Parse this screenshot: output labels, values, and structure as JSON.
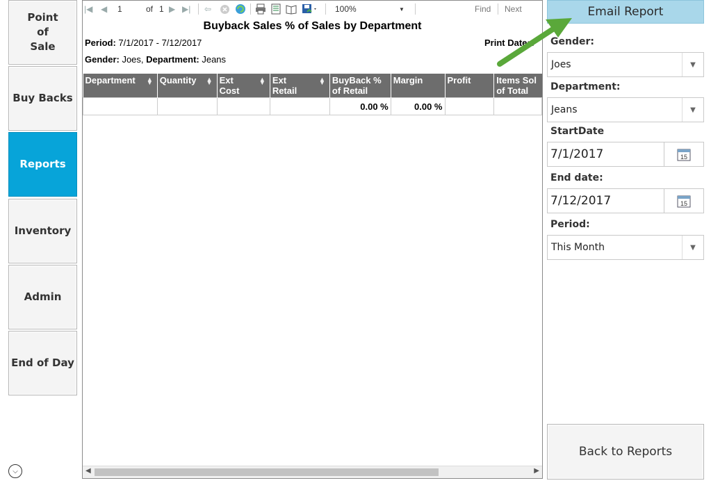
{
  "nav": {
    "point_of_sale": "Point\nof\nSale",
    "buy_backs": "Buy Backs",
    "reports": "Reports",
    "inventory": "Inventory",
    "admin": "Admin",
    "end_of_day": "End of Day"
  },
  "toolbar": {
    "page_current": "1",
    "page_of": "of",
    "page_total": "1",
    "zoom": "100%",
    "find": "Find",
    "next": "Next"
  },
  "report": {
    "title": "Buyback Sales % of Sales by Department",
    "period_label": "Period:",
    "period_value": " 7/1/2017 - 7/12/2017",
    "print_date_label": "Print Date:",
    "print_date_value": " /",
    "gender_label": "Gender:",
    "gender_value": " Joes,",
    "department_label": "Department:",
    "department_value": " Jeans",
    "columns": [
      "Department",
      "Quantity",
      "Ext\nCost",
      "Ext\nRetail",
      "BuyBack %\nof Retail",
      "Margin",
      "Profit",
      "Items Sol\nof Total"
    ],
    "row": [
      "",
      "",
      "",
      "",
      "0.00 %",
      "0.00 %",
      "",
      ""
    ]
  },
  "panel": {
    "email_button": "Email Report",
    "gender_label": "Gender:",
    "gender_value": "Joes",
    "department_label": "Department:",
    "department_value": "Jeans",
    "start_label": "StartDate",
    "start_value": "7/1/2017",
    "end_label": "End date:",
    "end_value": "7/12/2017",
    "calendar_day": "15",
    "period_label": "Period:",
    "period_value": "This Month",
    "back_button": "Back to Reports"
  },
  "colors": {
    "nav_active": "#07a4d9",
    "email_button": "#a9d7ea",
    "header_bg": "#6d6d6d",
    "annotation_arrow": "#5aa83a"
  },
  "icons": [
    "first-page-icon",
    "prev-page-icon",
    "next-page-icon",
    "last-page-icon",
    "back-icon",
    "stop-icon",
    "refresh-icon",
    "print-icon",
    "page-layout-icon",
    "page-setup-icon",
    "export-icon",
    "calendar-icon",
    "chevron-down-icon",
    "expand-icon"
  ]
}
